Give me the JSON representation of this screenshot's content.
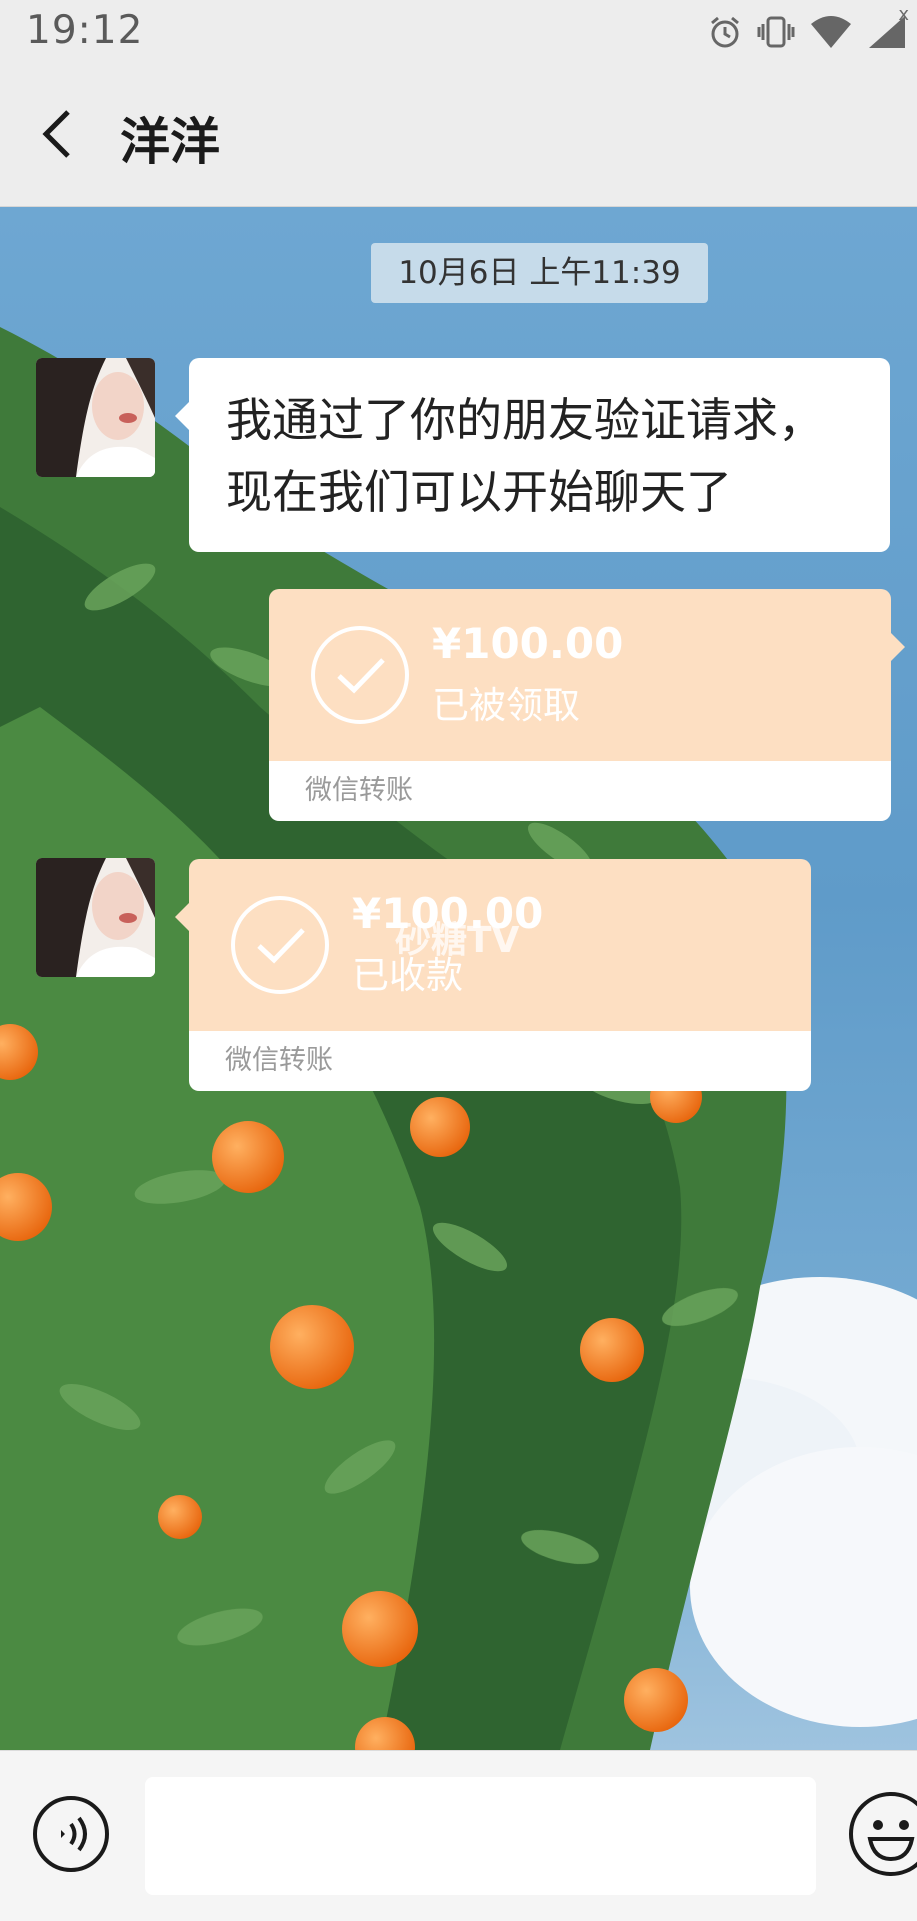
{
  "status_bar": {
    "time": "19:12",
    "close_glyph": "x",
    "icons": [
      "alarm-icon",
      "vibrate-icon",
      "wifi-icon",
      "signal-icon"
    ]
  },
  "header": {
    "back_icon": "chevron-left-icon",
    "title": "洋洋"
  },
  "chat": {
    "timestamp": "10月6日 上午11:39",
    "messages": [
      {
        "type": "text",
        "sender": "contact",
        "lines": [
          "我通过了你的朋友验证请求，",
          "现在我们可以开始聊天了"
        ]
      },
      {
        "type": "transfer",
        "sender": "self",
        "amount": "¥100.00",
        "status": "已被领取",
        "label": "微信转账",
        "icon": "check-circle-icon"
      },
      {
        "type": "transfer",
        "sender": "contact",
        "amount": "¥100.00",
        "status": "已收款",
        "label": "微信转账",
        "icon": "check-circle-icon",
        "watermark": "砂糖TV"
      }
    ]
  },
  "input_bar": {
    "voice_icon": "voice-icon",
    "input_value": "",
    "emoji_icon": "emoji-icon"
  },
  "colors": {
    "transfer_bg": "#fddfc2",
    "header_bg": "#ededed",
    "sky": "#6ea7d2",
    "orange": "#f07a1a",
    "leaf": "#3f7a3a"
  }
}
